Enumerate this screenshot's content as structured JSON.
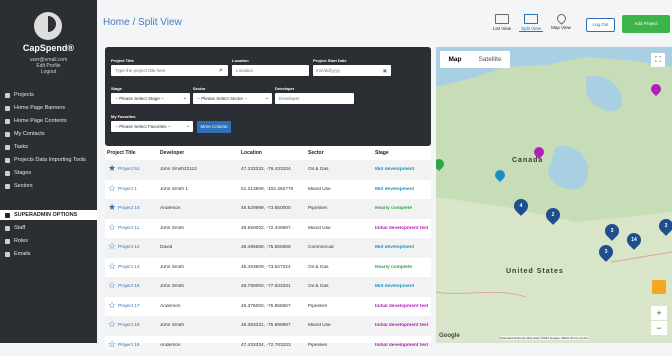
{
  "sidebar": {
    "brand": "CapSpend®",
    "user_email": "user@email.com",
    "edit_profile": "Edit Profile",
    "logout": "Logout",
    "items": [
      {
        "label": "Projects",
        "icon": "briefcase-icon"
      },
      {
        "label": "Home Page Banners",
        "icon": "image-icon"
      },
      {
        "label": "Home Page Contents",
        "icon": "document-icon"
      },
      {
        "label": "My Contacts",
        "icon": "address-book-icon"
      },
      {
        "label": "Tasks",
        "icon": "tasks-icon"
      },
      {
        "label": "Projects Data Importing Tools",
        "icon": "import-icon"
      },
      {
        "label": "Stages",
        "icon": "stages-icon"
      },
      {
        "label": "Sectors",
        "icon": "sectors-icon"
      },
      {
        "label": "SUPERADMIN OPTIONS",
        "icon": "lock-icon"
      },
      {
        "label": "Staff",
        "icon": "user-icon"
      },
      {
        "label": "Roles",
        "icon": "users-icon"
      },
      {
        "label": "Emails",
        "icon": "mail-icon"
      }
    ]
  },
  "header": {
    "breadcrumb_home": "Home",
    "breadcrumb_sep": "/",
    "breadcrumb_current": "Split View",
    "list_view": "List View",
    "split_view": "Split View",
    "map_view": "Map View",
    "log_out": "Log Out",
    "add_project": "Add Project"
  },
  "filters": {
    "project_title_label": "Project Title",
    "project_title_placeholder": "Type the project title here",
    "location_label": "Location",
    "location_placeholder": "Location",
    "start_date_label": "Project Start Date",
    "start_date_placeholder": "mm/dd/yyyy",
    "stage_label": "Stage",
    "stage_value": "-- Please Select Stage --",
    "sector_label": "Sector",
    "sector_value": "-- Please Select Sector --",
    "developer_label": "Developer",
    "developer_placeholder": "Developer",
    "favorites_label": "My Favorites",
    "favorites_value": "-- Please Select Favorites --",
    "more_column": "More Column"
  },
  "table": {
    "headers": [
      "Project Title",
      "Developer",
      "Location",
      "Sector",
      "Stage"
    ],
    "rows": [
      {
        "title": "Project 51",
        "developer": "John Smith22112",
        "location": "47.333332, -79.433334",
        "sector": "Oil & Gas",
        "stage": "Mid development",
        "starred": true
      },
      {
        "title": "Project 1",
        "developer": "John Smith 1",
        "location": "51.213808, -102.462776",
        "sector": "Mixed Use",
        "stage": "Mid development",
        "starred": false
      },
      {
        "title": "Project 10",
        "developer": "Anderson",
        "location": "45.529999, -73.650000",
        "sector": "Pipelines",
        "stage": "Nearly complete",
        "starred": true
      },
      {
        "title": "Project 11",
        "developer": "John Smith",
        "location": "48.650002, -72.449997",
        "sector": "Mixed Use",
        "stage": "Initial development test",
        "starred": false
      },
      {
        "title": "Project 12",
        "developer": "David",
        "location": "48.496668, -75.566666",
        "sector": "Commercial",
        "stage": "Mid development",
        "starred": false
      },
      {
        "title": "Project 14",
        "developer": "John Smith",
        "location": "45.453609, -73.647224",
        "sector": "Oil & Gas",
        "stage": "Nearly complete",
        "starred": false
      },
      {
        "title": "Project 16",
        "developer": "John Smith",
        "location": "49.750000, -77.633331",
        "sector": "Oil & Gas",
        "stage": "Mid development",
        "starred": false
      },
      {
        "title": "Project 17",
        "developer": "Anderson",
        "location": "46.375000, -75.966667",
        "sector": "Pipelines",
        "stage": "Initial development test",
        "starred": false
      },
      {
        "title": "Project 18",
        "developer": "John Smith",
        "location": "45.383331, -75.699997",
        "sector": "Mixed Use",
        "stage": "Initial development test",
        "starred": false
      },
      {
        "title": "Project 19",
        "developer": "Anderson",
        "location": "47.433334, -72.783333",
        "sector": "Pipelines",
        "stage": "Initial development test",
        "starred": false
      }
    ]
  },
  "map": {
    "tab_map": "Map",
    "tab_satellite": "Satellite",
    "label_canada": "Canada",
    "label_us": "United States",
    "clusters": [
      "4",
      "2",
      "3",
      "14",
      "3",
      "3"
    ],
    "google": "Google",
    "footer": "Keyboard shortcuts   Map data ©2021 Google, INEGI   Terms of Use",
    "zoom_in": "+",
    "zoom_out": "−"
  },
  "colors": {
    "sidebar_bg": "#2b2f33",
    "accent": "#2e6fb8",
    "add_button": "#3bb54a",
    "mid_development": "#1c8fc9",
    "nearly_complete": "#2ca64a",
    "initial_development": "#b020b8"
  }
}
